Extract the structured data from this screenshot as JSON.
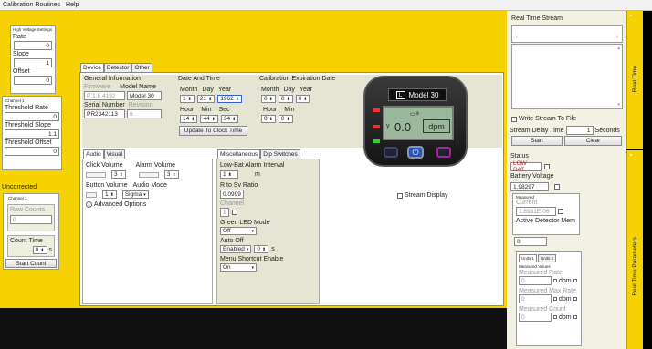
{
  "menu": [
    "Calibration Routines",
    "Help"
  ],
  "left": {
    "hv_title": "High Voltage Settings",
    "rate_label": "Rate",
    "rate_value": "0",
    "slope_label": "Slope",
    "slope_value": "1",
    "offset_label": "Offset",
    "offset_value": "0",
    "ch_title": "Channel 1",
    "thr_rate_label": "Threshold Rate",
    "thr_rate_value": "0",
    "thr_slope_label": "Threshold Slope",
    "thr_slope_value": "1.1",
    "thr_offset_label": "Threshold Offset",
    "thr_offset_value": "0",
    "uncorrected": "Uncorrected",
    "ch_title2": "Channel 1",
    "raw_counts_label": "Raw Counts",
    "raw_counts_value": "0",
    "count_time_label": "Count Time",
    "count_time_value": "0",
    "count_time_unit": "s",
    "start_count": "Start Count"
  },
  "tabs": [
    "Device",
    "Detector",
    "Other"
  ],
  "general": {
    "title": "General Information",
    "firmware_label": "Firmware",
    "model_label": "Model Name",
    "firmware_value": "P:1.8.4192",
    "model_value": "Model 30",
    "serial_label": "Serial Number",
    "revision_label": "Revision",
    "serial_value": "PR2342113",
    "revision_value": "6"
  },
  "datetime": {
    "title": "Date And Time",
    "month_label": "Month",
    "day_label": "Day",
    "year_label": "Year",
    "month": "1",
    "day": "21",
    "year": "1962",
    "hour_label": "Hour",
    "min_label": "Min",
    "sec_label": "Sec",
    "hour": "14",
    "min": "44",
    "sec": "34",
    "update_btn": "Update To Clock Time"
  },
  "calexp": {
    "title": "Calibration Expiration Date",
    "month_label": "Month",
    "day_label": "Day",
    "year_label": "Year",
    "month": "0",
    "day": "0",
    "year": "0",
    "hour_label": "Hour",
    "min_label": "Min",
    "hour": "0",
    "min": "0"
  },
  "device": {
    "model": "Model 30",
    "reading": "0.0",
    "unit": "dpm"
  },
  "stream_display": "Stream Display",
  "audio": {
    "tabs": [
      "Audio",
      "Visual"
    ],
    "click_volume": "Click Volume",
    "alarm_volume": "Alarm Volume",
    "click_val": "3",
    "alarm_val": "3",
    "button_volume": "Button Volume",
    "audio_mode": "Audio Mode",
    "button_val": "1",
    "audio_mode_val": "Sigma",
    "advanced": "Advanced Options"
  },
  "misc": {
    "tabs": [
      "Miscellaneous",
      "Dip Switches"
    ],
    "lowbat_label": "Low-Bat Alarm Interval",
    "lowbat_val": "1",
    "lowbat_unit": "m",
    "r_to_sv_label": "R to Sv Ratio",
    "r_to_sv_val": "0.0999",
    "channel_label": "Channel",
    "channel_val": "1",
    "green_led_label": "Green LED Mode",
    "green_led_val": "Off",
    "autooff_label": "Auto Off",
    "autooff_val": "Enabled",
    "autooff_num": "0",
    "autooff_unit": "s",
    "menu_shortcut_label": "Menu Shortcut Enable",
    "menu_shortcut_val": "On"
  },
  "stream": {
    "title": "Real Time Stream",
    "write_file": "Write Stream To File",
    "delay_label": "Stream Delay Time",
    "delay_val": "1",
    "delay_unit": "Seconds",
    "start": "Start",
    "clear": "Clear",
    "side_tab": "Real Time"
  },
  "status": {
    "title": "Status",
    "low_bat": "LOW BAT",
    "battery_label": "Battery Voltage",
    "battery_val": "1.98297",
    "measured_title": "Measured",
    "current_label": "Current",
    "current_val": "1.8931E-06",
    "active_mem": "Active Detector Mem",
    "active_mem_val": "0",
    "units_tabs": [
      "Units 1",
      "Units 2"
    ],
    "measured_values": "Measured Values",
    "rate_label": "Measured Rate",
    "rate_val": "0",
    "rate_unit": "dpm",
    "max_label": "Measured Max Rate",
    "max_val": "0",
    "max_unit": "dpm",
    "count_label": "Measured Count",
    "count_val": "0",
    "count_unit": "dpm",
    "side_tab": "Real Time Parameters"
  }
}
